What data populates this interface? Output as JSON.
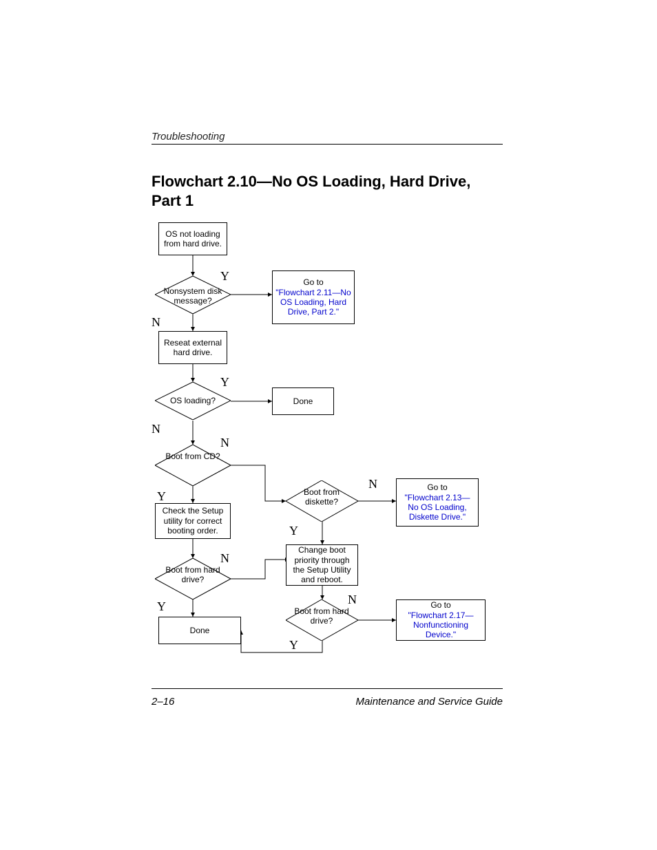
{
  "header": {
    "section": "Troubleshooting"
  },
  "title": "Flowchart 2.10—No OS Loading, Hard Drive, Part 1",
  "footer": {
    "page": "2–16",
    "guide": "Maintenance and Service Guide"
  },
  "labels": {
    "Y": "Y",
    "N": "N"
  },
  "nodes": {
    "start": "OS not loading from hard drive.",
    "q_nonsystem": "Nonsystem disk message?",
    "goto_211_pre": "Go to",
    "goto_211_link": "\"Flowchart 2.11—No OS Loading, Hard Drive, Part 2.\"",
    "reseat": "Reseat external hard drive.",
    "q_osloading": "OS loading?",
    "done1": "Done",
    "q_bootcd": "Boot from CD?",
    "check_setup": "Check the Setup utility for correct booting order.",
    "q_bootdiskette": "Boot from diskette?",
    "goto_213_pre": "Go to",
    "goto_213_link": "\"Flowchart 2.13—No OS Loading, Diskette Drive.\"",
    "change_boot": "Change boot priority through the Setup Utility and reboot.",
    "q_boothd2": "Boot from hard drive?",
    "q_boothd3": "Boot from hard drive?",
    "goto_217_pre": "Go to",
    "goto_217_link": "\"Flowchart 2.17—Nonfunctioning Device.\"",
    "done2": "Done"
  }
}
